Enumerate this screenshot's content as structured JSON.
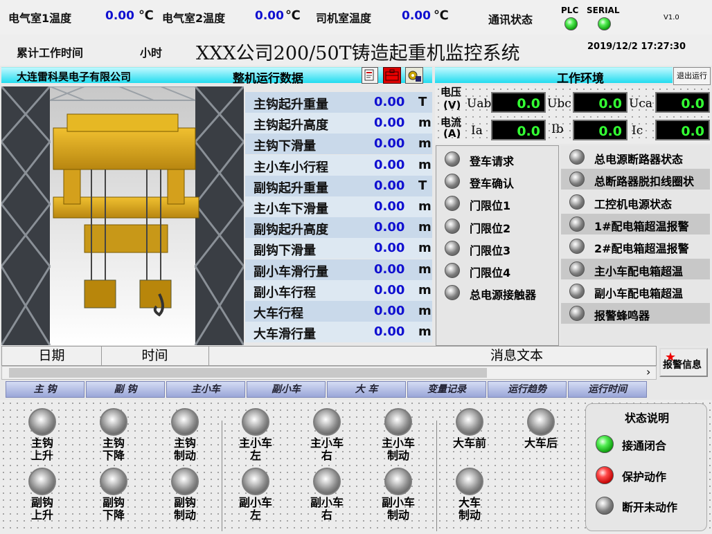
{
  "header": {
    "temp1_label": "电气室1温度",
    "temp1_value": "0.00",
    "temp1_unit": "℃",
    "temp2_label": "电气室2温度",
    "temp2_value": "0.00",
    "temp2_unit": "℃",
    "driver_temp_label": "司机室温度",
    "driver_temp_value": "0.00",
    "driver_temp_unit": "℃",
    "comm_label": "通讯状态",
    "plc_label": "PLC",
    "serial_label": "SERIAL",
    "version": "V1.0",
    "work_time_label": "累计工作时间",
    "hours_label": "小时",
    "title": "XXX公司200/50T铸造起重机监控系统",
    "datetime": "2019/12/2 17:27:30"
  },
  "left_panel": {
    "company": "大连雷科昊电子有限公司",
    "section_title": "整机运行数据",
    "icons": [
      "document-icon",
      "toolbox-icon",
      "settings-icon"
    ]
  },
  "run_data": [
    {
      "label": "主钩起升重量",
      "value": "0.00",
      "unit": "T"
    },
    {
      "label": "主钩起升高度",
      "value": "0.00",
      "unit": "m"
    },
    {
      "label": "主钩下滑量",
      "value": "0.00",
      "unit": "m"
    },
    {
      "label": "主小车小行程",
      "value": "0.00",
      "unit": "m"
    },
    {
      "label": "副钩起升重量",
      "value": "0.00",
      "unit": "T"
    },
    {
      "label": "主小车下滑量",
      "value": "0.00",
      "unit": "m"
    },
    {
      "label": "副钩起升高度",
      "value": "0.00",
      "unit": "m"
    },
    {
      "label": "副钩下滑量",
      "value": "0.00",
      "unit": "m"
    },
    {
      "label": "副小车滑行量",
      "value": "0.00",
      "unit": "m"
    },
    {
      "label": "副小车行程",
      "value": "0.00",
      "unit": "m"
    },
    {
      "label": "大车行程",
      "value": "0.00",
      "unit": "m"
    },
    {
      "label": "大车滑行量",
      "value": "0.00",
      "unit": "m"
    }
  ],
  "environment": {
    "title": "工作环境",
    "exit_button": "退出运行",
    "voltage_label": "电压",
    "voltage_unit": "(V)",
    "current_label": "电流",
    "current_unit": "(A)",
    "uab_label": "Uab",
    "uab_value": "0.0",
    "ubc_label": "Ubc",
    "ubc_value": "0.0",
    "uca_label": "Uca",
    "uca_value": "0.0",
    "ia_label": "Ia",
    "ia_value": "0.0",
    "ib_label": "Ib",
    "ib_value": "0.0",
    "ic_label": "Ic",
    "ic_value": "0.0"
  },
  "left_status": [
    "登车请求",
    "登车确认",
    "门限位1",
    "门限位2",
    "门限位3",
    "门限位4",
    "总电源接触器"
  ],
  "right_status": [
    "总电源断路器状态",
    "总断路器脱扣线圈状",
    "工控机电源状态",
    "1#配电箱超温报警",
    "2#配电箱超温报警",
    "主小车配电箱超温",
    "副小车配电箱超温",
    "报警蜂鸣器"
  ],
  "alarm_table": {
    "col_date": "日期",
    "col_time": "时间",
    "col_message": "消息文本",
    "alarm_button": "报警信息",
    "scroll_arrow": "›"
  },
  "tabs": [
    "主  钩",
    "副  钩",
    "主小车",
    "副小车",
    "大  车",
    "变量记录",
    "运行趋势",
    "运行时间"
  ],
  "controls": {
    "row1": [
      {
        "line1": "主钩",
        "line2": "上升"
      },
      {
        "line1": "主钩",
        "line2": "下降"
      },
      {
        "line1": "主钩",
        "line2": "制动"
      },
      {
        "line1": "主小车",
        "line2": "左"
      },
      {
        "line1": "主小车",
        "line2": "右"
      },
      {
        "line1": "主小车",
        "line2": "制动"
      },
      {
        "line1": "大车前",
        "line2": ""
      },
      {
        "line1": "大车后",
        "line2": ""
      }
    ],
    "row2": [
      {
        "line1": "副钩",
        "line2": "上升"
      },
      {
        "line1": "副钩",
        "line2": "下降"
      },
      {
        "line1": "副钩",
        "line2": "制动"
      },
      {
        "line1": "副小车",
        "line2": "左"
      },
      {
        "line1": "副小车",
        "line2": "右"
      },
      {
        "line1": "副小车",
        "line2": "制动"
      },
      {
        "line1": "大车",
        "line2": "制动"
      }
    ]
  },
  "legend": {
    "title": "状态说明",
    "items": [
      {
        "label": "接通闭合",
        "color": "green"
      },
      {
        "label": "保护动作",
        "color": "red"
      },
      {
        "label": "断开未动作",
        "color": "gray"
      }
    ]
  }
}
